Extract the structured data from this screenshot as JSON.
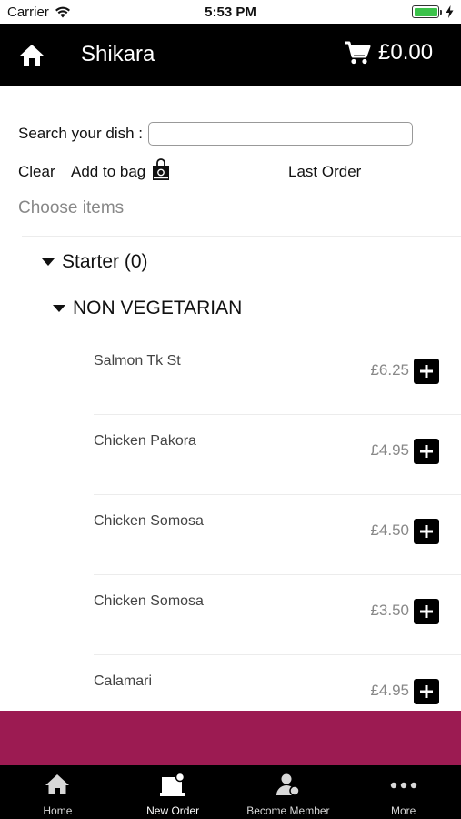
{
  "status_bar": {
    "carrier": "Carrier",
    "time": "5:53 PM"
  },
  "header": {
    "title": "Shikara",
    "cart_total": "£0.00",
    "background": "#000000"
  },
  "search": {
    "label": "Search your dish :",
    "value": "",
    "placeholder": ""
  },
  "actions": {
    "clear_label": "Clear",
    "add_to_bag_label": "Add to bag",
    "last_order_label": "Last Order"
  },
  "menu": {
    "heading": "Choose items",
    "category": {
      "label": "Starter (0)",
      "subcategory": "NON VEGETARIAN",
      "items": [
        {
          "name": "Salmon Tk St",
          "price": "£6.25"
        },
        {
          "name": "Chicken Pakora",
          "price": "£4.95"
        },
        {
          "name": "Chicken Somosa",
          "price": "£4.50"
        },
        {
          "name": "Chicken Somosa",
          "price": "£3.50"
        },
        {
          "name": "Calamari",
          "price": "£4.95"
        }
      ]
    }
  },
  "promo_band_color": "#9c1b52",
  "tabs": [
    {
      "label": "Home",
      "icon": "home-icon",
      "active": false
    },
    {
      "label": "New Order",
      "icon": "new-order-icon",
      "active": true
    },
    {
      "label": "Become Member",
      "icon": "member-icon",
      "active": false
    },
    {
      "label": "More",
      "icon": "more-icon",
      "active": false
    }
  ]
}
